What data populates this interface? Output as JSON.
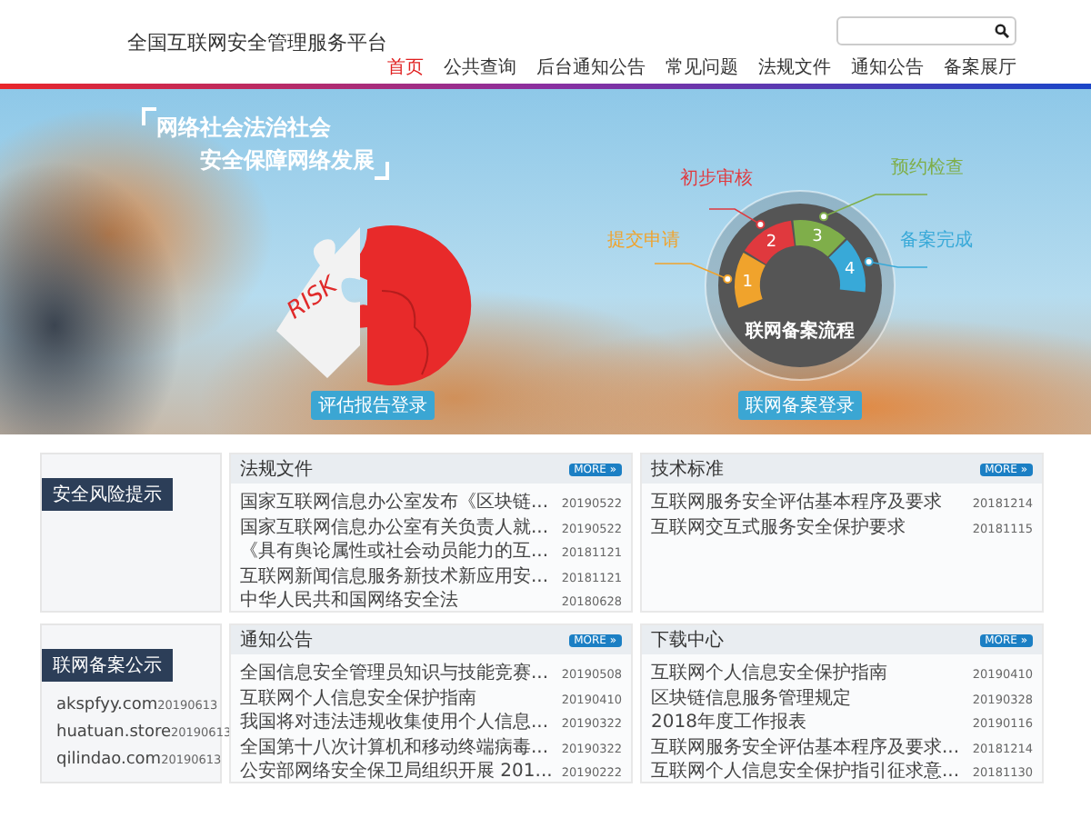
{
  "header": {
    "title": "全国互联网安全管理服务平台"
  },
  "nav": [
    {
      "label": "首页",
      "selected": true
    },
    {
      "label": "公共查询",
      "selected": false
    },
    {
      "label": "后台通知公告",
      "selected": false
    },
    {
      "label": "常见问题",
      "selected": false
    },
    {
      "label": "法规文件",
      "selected": false
    },
    {
      "label": "通知公告",
      "selected": false
    },
    {
      "label": "备案展厅",
      "selected": false
    }
  ],
  "banner": {
    "slogan": [
      "网络社会法治社会",
      "安全保障网络发展"
    ],
    "risk_label": "RISK",
    "risk_button": "评估报告登录",
    "flow": {
      "title": "联网备案流程",
      "stages": [
        {
          "number": "1",
          "label": "提交申请",
          "color": "#f0a32c"
        },
        {
          "number": "2",
          "label": "初步审核",
          "color": "#e0393e"
        },
        {
          "number": "3",
          "label": "预约检查",
          "color": "#7fae4a"
        },
        {
          "number": "4",
          "label": "备案完成",
          "color": "#38a9d8"
        }
      ]
    },
    "flow_button": "联网备案登录"
  },
  "sidebar": [
    {
      "title": "安全风险提示"
    },
    {
      "title": "联网备案公示",
      "items": [
        {
          "text": "akspfyy.com",
          "date": "20190613"
        },
        {
          "text": "huatuan.store",
          "date": "20190613"
        },
        {
          "text": "qilindao.com",
          "date": "20190613"
        }
      ]
    }
  ],
  "panels": [
    {
      "title": "法规文件",
      "more": "MORE »",
      "items": [
        {
          "text": "国家互联网信息办公室发布《区块链...",
          "date": "20190522"
        },
        {
          "text": "国家互联网信息办公室有关负责人就...",
          "date": "20190522"
        },
        {
          "text": "《具有舆论属性或社会动员能力的互...",
          "date": "20181121"
        },
        {
          "text": "互联网新闻信息服务新技术新应用安...",
          "date": "20181121"
        },
        {
          "text": "中华人民共和国网络安全法",
          "date": "20180628"
        }
      ]
    },
    {
      "title": "技术标准",
      "more": "MORE »",
      "items": [
        {
          "text": "互联网服务安全评估基本程序及要求",
          "date": "20181214"
        },
        {
          "text": "互联网交互式服务安全保护要求",
          "date": "20181115"
        }
      ]
    },
    {
      "title": "通知公告",
      "more": "MORE »",
      "items": [
        {
          "text": "全国信息安全管理员知识与技能竞赛...",
          "date": "20190508"
        },
        {
          "text": "互联网个人信息安全保护指南",
          "date": "20190410"
        },
        {
          "text": "我国将对违法违规收集使用个人信息...",
          "date": "20190322"
        },
        {
          "text": "全国第十八次计算机和移动终端病毒...",
          "date": "20190322"
        },
        {
          "text": "公安部网络安全保卫局组织开展 201...",
          "date": "20190222"
        }
      ]
    },
    {
      "title": "下载中心",
      "more": "MORE »",
      "items": [
        {
          "text": "互联网个人信息安全保护指南",
          "date": "20190410"
        },
        {
          "text": "区块链信息服务管理规定",
          "date": "20190328"
        },
        {
          "text": "2018年度工作报表",
          "date": "20190116"
        },
        {
          "text": "互联网服务安全评估基本程序及要求...",
          "date": "20181214"
        },
        {
          "text": "互联网个人信息安全保护指引征求意...",
          "date": "20181130"
        }
      ]
    }
  ]
}
